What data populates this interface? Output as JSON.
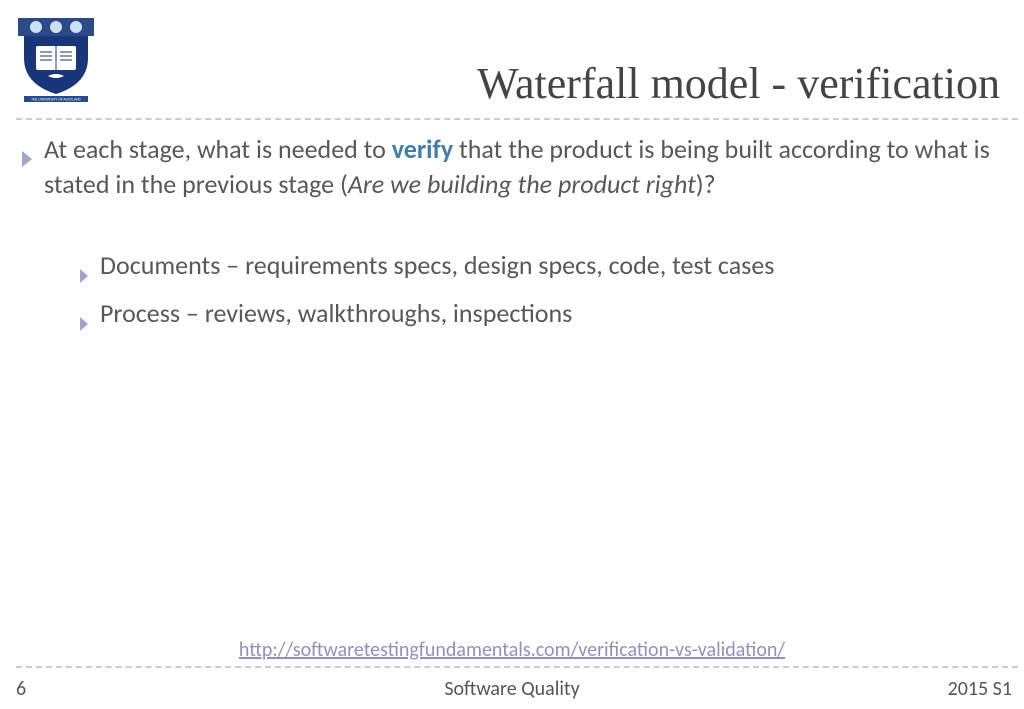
{
  "title": "Waterfall model - verification",
  "main_bullet": {
    "pre": "At each stage, what is needed to ",
    "highlight": "verify",
    "mid": " that the product is being built according to what is stated in the previous stage  (",
    "italic": "Are we building the product right",
    "post": ")?"
  },
  "sub_bullets": [
    "Documents – requirements specs, design specs, code, test cases",
    "Process – reviews, walkthroughs, inspections"
  ],
  "link_text": "http://softwaretestingfundamentals.com/verification-vs-validation/",
  "footer": {
    "page": "6",
    "center": "Software Quality",
    "right": "2015 S1"
  }
}
